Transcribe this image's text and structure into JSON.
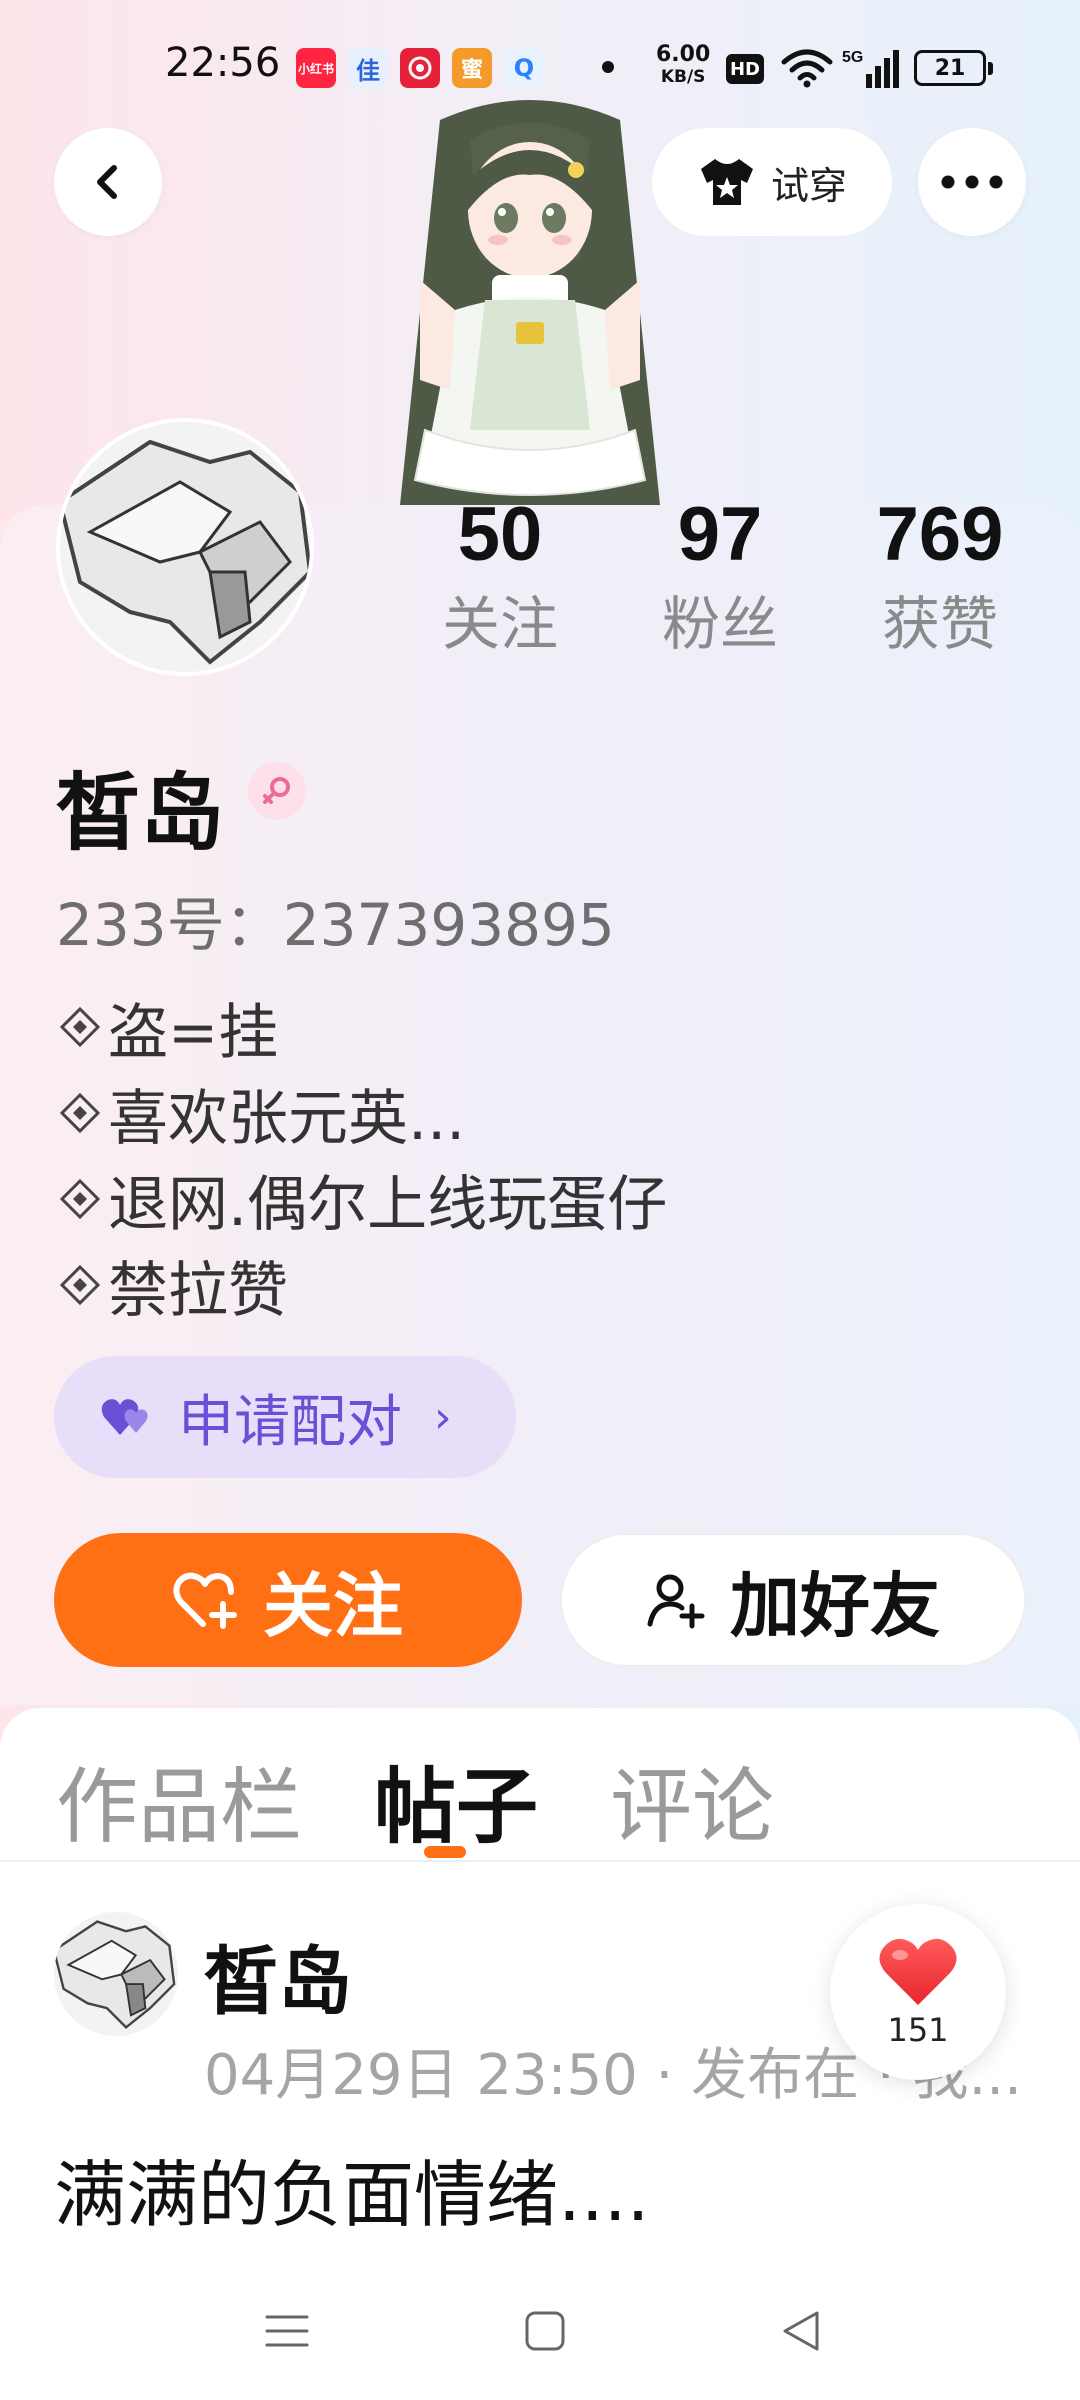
{
  "status_bar": {
    "time": "22:56",
    "app_icons": [
      {
        "name": "xiaohongshu-icon",
        "label": "小红书",
        "color": "#ff2442"
      },
      {
        "name": "jia-icon",
        "label": "佳",
        "color": "#e8f0ff"
      },
      {
        "name": "gift-app-icon",
        "label": "",
        "color": "#e5223a"
      },
      {
        "name": "shop-app-icon",
        "label": "蜜",
        "color": "#f39a2b"
      },
      {
        "name": "search-app-icon",
        "label": "Q",
        "color": "#e8f2ff"
      }
    ],
    "net_speed_value": "6.00",
    "net_speed_unit": "KB/S",
    "hd_label": "HD",
    "signal_label": "5G",
    "battery": "21"
  },
  "header": {
    "tryon_label": "试穿"
  },
  "profile": {
    "name": "皙岛",
    "gender": "female",
    "uid": "233号：237393895",
    "stats": [
      {
        "value": "50",
        "label": "关注"
      },
      {
        "value": "97",
        "label": "粉丝"
      },
      {
        "value": "769",
        "label": "获赞"
      }
    ],
    "bio": [
      "盗=挂",
      "喜欢张元英...",
      "退网.偶尔上线玩蛋仔",
      "禁拉赞"
    ],
    "pair_label": "申请配对"
  },
  "actions": {
    "follow_label": "关注",
    "add_friend_label": "加好友"
  },
  "tabs": [
    {
      "label": "作品栏",
      "active": false
    },
    {
      "label": "帖子",
      "active": true
    },
    {
      "label": "评论",
      "active": false
    }
  ],
  "post": {
    "author": "皙岛",
    "meta": "04月29日 23:50 · 发布在 · 我...",
    "text": "满满的负面情绪....",
    "likes": "151"
  },
  "colors": {
    "accent": "#ff7015",
    "pair_bg": "#e7defa",
    "pair_text": "#6b4fd6"
  }
}
